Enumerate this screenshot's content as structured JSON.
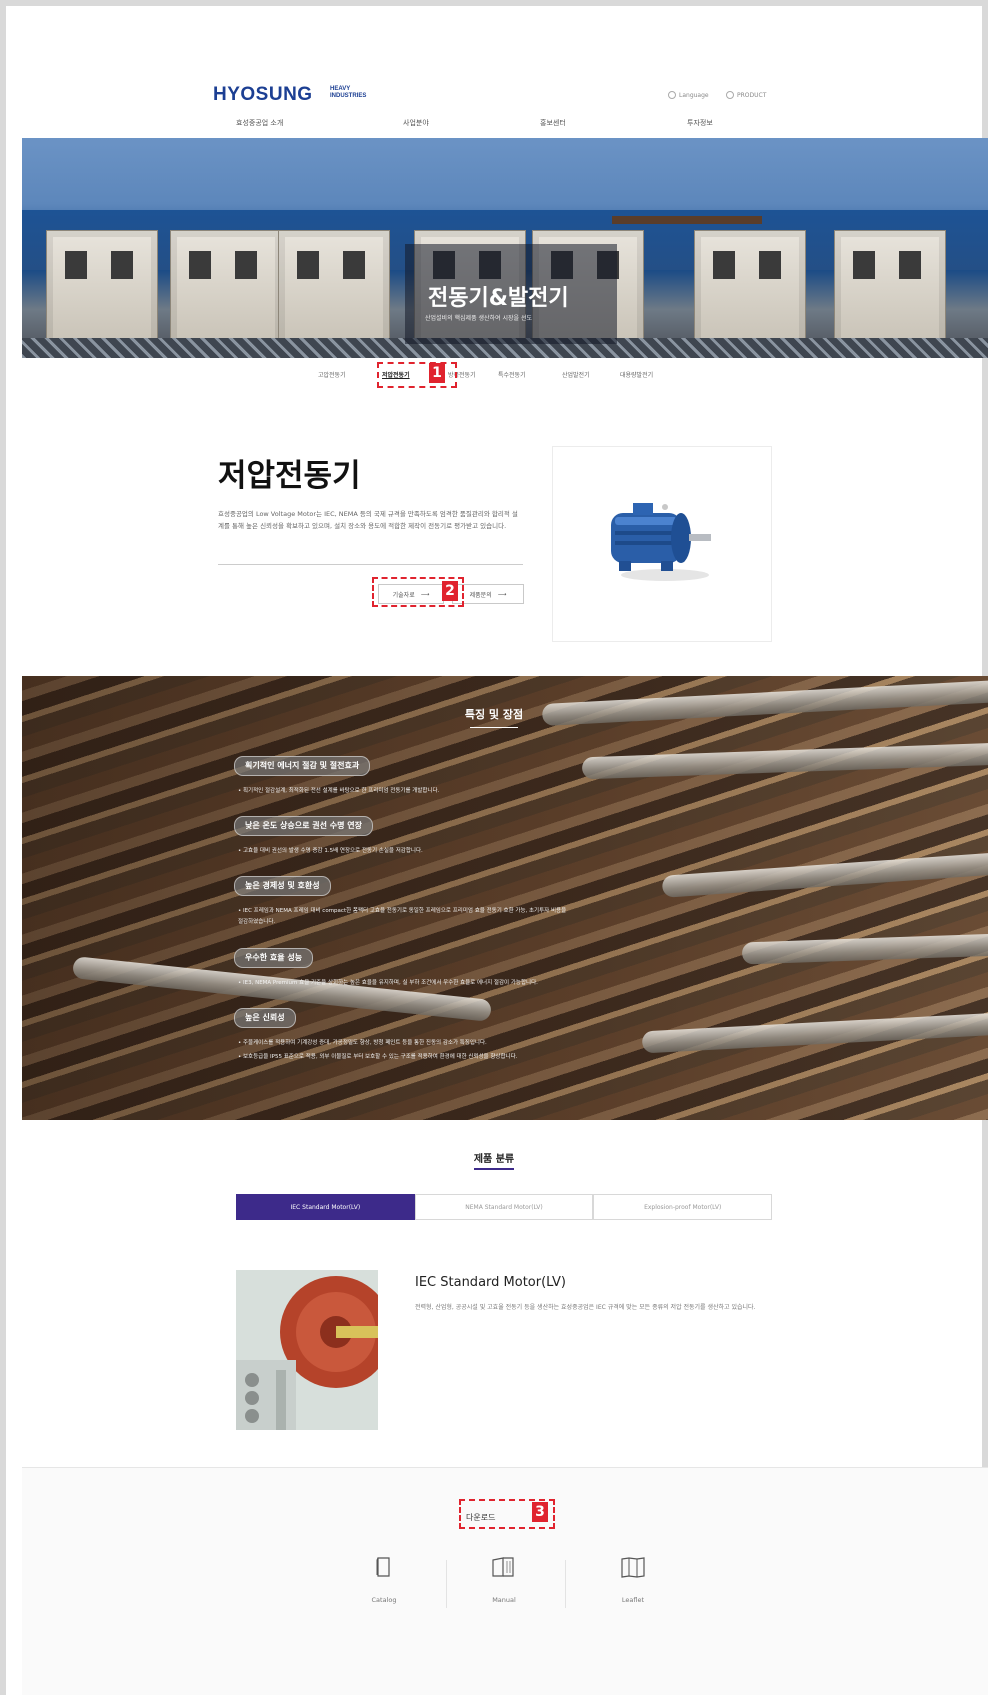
{
  "header": {
    "logo": "HYOSUNG",
    "logo_sub": "HEAVY INDUSTRIES",
    "util": [
      "Language",
      "PRODUCT"
    ],
    "nav": [
      "효성중공업 소개",
      "사업분야",
      "홍보센터",
      "투자정보"
    ]
  },
  "hero": {
    "title": "전동기&발전기",
    "subtitle": "산업설비의 핵심제품 생산하여 시장을 선도"
  },
  "subnav": [
    "고압전동기",
    "저압전동기",
    "방폭전동기",
    "특수전동기",
    "산업발전기",
    "대용량발전기"
  ],
  "callouts": [
    "1",
    "2",
    "3"
  ],
  "intro": {
    "title": "저압전동기",
    "description": "효성중공업의 Low Voltage Motor는 IEC, NEMA 등의 국제 규격을 만족하도록 엄격한 품질관리와 합리적 설계를 통해 높은 신뢰성을 확보하고 있으며, 설치 장소와 용도에 적합한 제작이 전동기로 평가받고 있습니다.",
    "buttons": [
      "기술자료",
      "제품문의"
    ]
  },
  "features": {
    "title": "특징 및 장점",
    "items": [
      {
        "heading": "획기적인 에너지 절감 및 절전효과",
        "desc": [
          "• 획기적인 절감설계, 최적화된 전선 설계를 바탕으로 한 프리미엄 전동기를 개발합니다."
        ]
      },
      {
        "heading": "낮은 온도 상승으로 권선 수명 연장",
        "desc": [
          "• 고효율 대비 권선의 발생 수명 증감 1.5배 연장으로 전동기 손실을 저감합니다."
        ]
      },
      {
        "heading": "높은 경제성 및 호환성",
        "desc": [
          "• IEC 프레임과 NEMA 프레임 대비 compact한 폼팩터 고효율 전동기로 동일한 프레임으로 프리미엄 효율 전동기 호환 가능, 초기투자 비용을",
          "절감하였습니다."
        ]
      },
      {
        "heading": "우수한 효율 성능",
        "desc": [
          "• IE3, NEMA Premium 효율 기준을 상회하는 높은 효율을 유지하며, 실 부하 조건에서 우수한 효율로 에너지 절감이 가능합니다."
        ]
      },
      {
        "heading": "높은 신뢰성",
        "desc": [
          "• 주물케이스를 적용하여 기계강성 증대, 가공정밀도 향상, 방청 페인트 등을 통한 진동의 감소가 특징입니다.",
          "• 보호등급을 IP55 표준으로 적용, 외부 이물질로 부터 보호할 수 있는 구조를 적용하여 환경에 대한 신뢰성을 향상합니다."
        ]
      }
    ]
  },
  "products": {
    "title": "제품 분류",
    "tabs": [
      "IEC Standard Motor(LV)",
      "NEMA Standard Motor(LV)",
      "Explosion-proof Motor(LV)"
    ],
    "selected_index": 0,
    "name": "IEC Standard Motor(LV)",
    "description": "전력형, 산업형, 공공시설 및 고효율 전동기 등을 생산하는 효성중공업은 IEC 규격에 맞는 모든 종류의 저압 전동기를 생산하고 있습니다."
  },
  "download": {
    "title": "다운로드",
    "items": [
      {
        "label": "Catalog",
        "icon": "catalog-icon"
      },
      {
        "label": "Manual",
        "icon": "manual-icon"
      },
      {
        "label": "Leaflet",
        "icon": "leaflet-icon"
      }
    ]
  },
  "colors": {
    "brand": "#1c3f93",
    "accent": "#3d2a8a",
    "callout": "#e0232e"
  }
}
